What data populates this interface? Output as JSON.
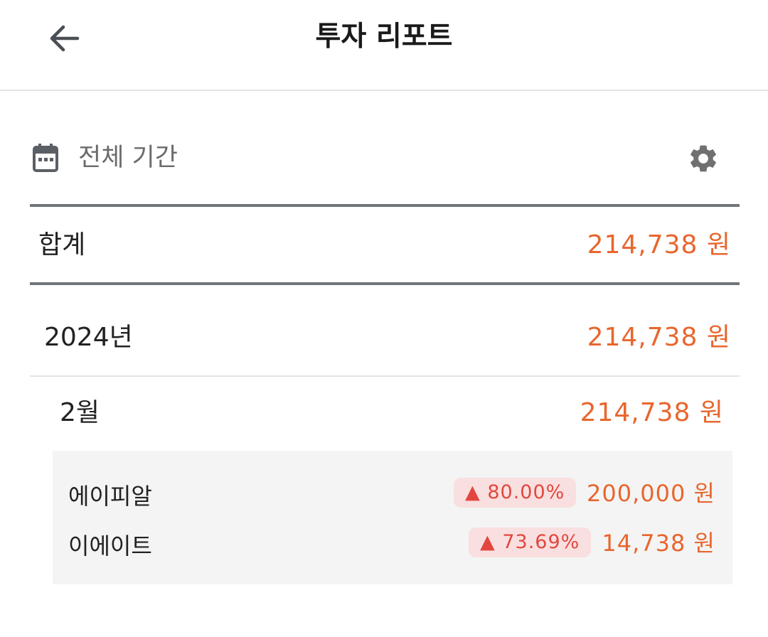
{
  "header": {
    "title": "투자 리포트"
  },
  "period": {
    "label": "전체 기간"
  },
  "total": {
    "label": "합계",
    "amount": "214,738 원"
  },
  "year": {
    "label": "2024년",
    "amount": "214,738 원"
  },
  "month": {
    "label": "2월",
    "amount": "214,738 원"
  },
  "stocks": [
    {
      "name": "에이피알",
      "change": "▲ 80.00%",
      "amount": "200,000 원"
    },
    {
      "name": "이에이트",
      "change": "▲ 73.69%",
      "amount": "14,738 원"
    }
  ],
  "colors": {
    "accent": "#e8662e",
    "badge_bg": "#f9dfdf",
    "badge_text": "#e2473f",
    "divider_strong": "#70757c"
  },
  "icons": [
    "arrow-left-icon",
    "calendar-icon",
    "gear-icon",
    "triangle-up-icon"
  ]
}
